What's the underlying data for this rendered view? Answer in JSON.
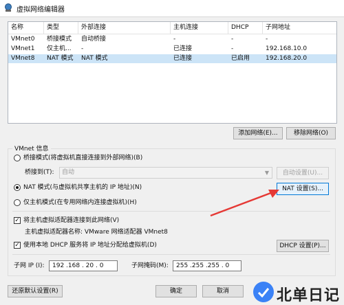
{
  "window": {
    "title": "虚拟网络编辑器"
  },
  "table": {
    "headers": [
      "名称",
      "类型",
      "外部连接",
      "主机连接",
      "DHCP",
      "子网地址"
    ],
    "rows": [
      [
        "VMnet0",
        "桥接模式",
        "自动桥接",
        "-",
        "-",
        "-"
      ],
      [
        "VMnet1",
        "仅主机...",
        "-",
        "已连接",
        "-",
        "192.168.10.0"
      ],
      [
        "VMnet8",
        "NAT 模式",
        "NAT 模式",
        "已连接",
        "已启用",
        "192.168.20.0"
      ]
    ],
    "selected_row": 2
  },
  "list_buttons": {
    "add": "添加网络(E)...",
    "remove": "移除网络(O)"
  },
  "vmnet_info": {
    "group_title": "VMnet 信息",
    "bridged_label": "桥接模式(将虚拟机直接连接到外部网络)(B)",
    "bridged_to_label": "桥接到(T):",
    "bridged_to_value": "自动",
    "auto_settings": "自动设置(U)...",
    "nat_label": "NAT 模式(与虚拟机共享主机的 IP 地址)(N)",
    "nat_settings": "NAT 设置(S)...",
    "hostonly_label": "仅主机模式(在专用网络内连接虚拟机)(H)",
    "selected_mode": "nat",
    "connect_adapter_label": "将主机虚拟适配器连接到此网络(V)",
    "connect_adapter_checked": true,
    "adapter_name_label": "主机虚拟适配器名称: VMware 网络适配器 VMnet8",
    "dhcp_label": "使用本地 DHCP 服务将 IP 地址分配给虚拟机(D)",
    "dhcp_checked": true,
    "dhcp_settings": "DHCP 设置(P)...",
    "subnet_ip_label": "子网 IP (I):",
    "subnet_ip_value": "192 .168 . 20 . 0",
    "subnet_mask_label": "子网掩码(M):",
    "subnet_mask_value": "255 .255 .255 . 0"
  },
  "footer": {
    "restore": "还原默认设置(R)",
    "ok": "确定",
    "cancel": "取消"
  },
  "watermark": {
    "text": "北单日记"
  },
  "colors": {
    "selection": "#cce4f7",
    "focus_border": "#0078d7",
    "arrow": "#e53935"
  }
}
